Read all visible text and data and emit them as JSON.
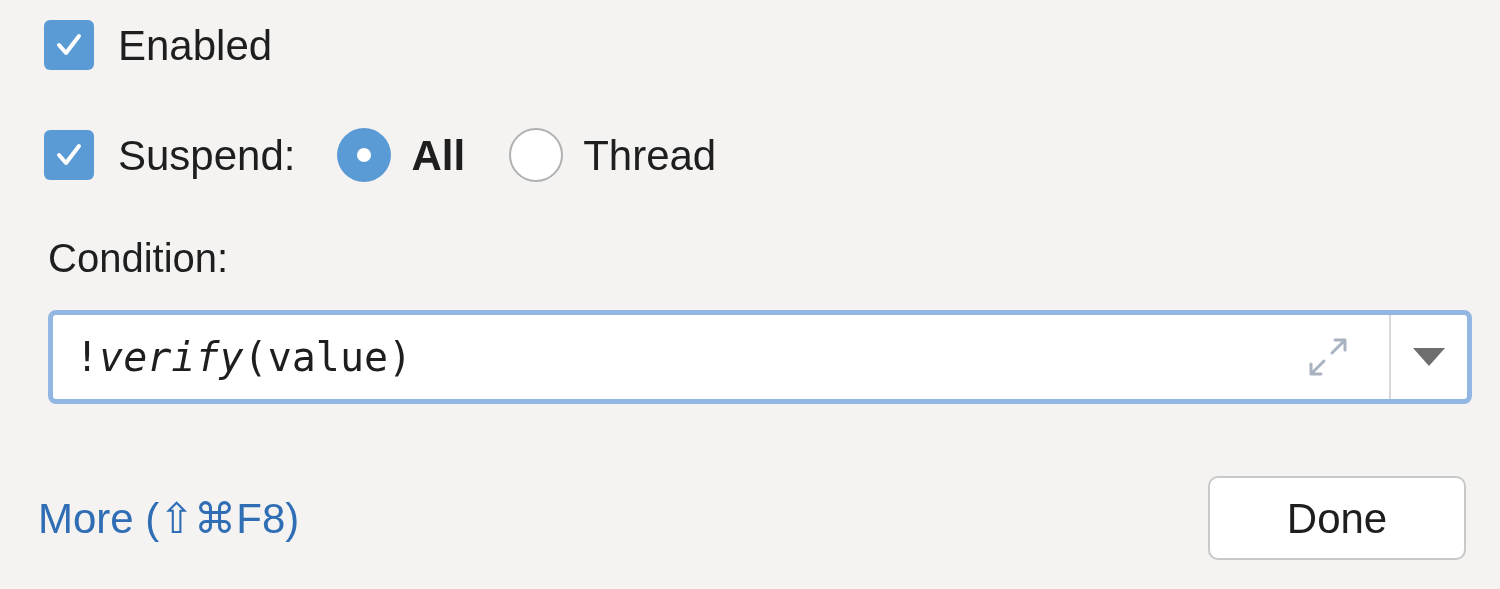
{
  "enabled": {
    "label": "Enabled",
    "checked": true
  },
  "suspend": {
    "label": "Suspend:",
    "checked": true,
    "options": [
      {
        "label": "All",
        "selected": true
      },
      {
        "label": "Thread",
        "selected": false
      }
    ]
  },
  "condition": {
    "label": "Condition:",
    "value": "!*verify*(value)"
  },
  "more_link": "More (⇧⌘F8)",
  "done_button": "Done"
}
